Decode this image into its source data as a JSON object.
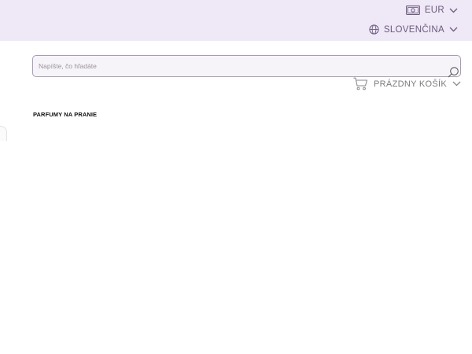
{
  "header": {
    "currency": {
      "label": "EUR",
      "icon": "banknote-icon"
    },
    "language": {
      "label": "SLOVENČINA",
      "icon": "globe-icon"
    }
  },
  "search": {
    "placeholder": "Napíšte, čo hľadáte",
    "value": "",
    "icon": "search-icon"
  },
  "cart": {
    "label": "PRÁZDNY KOŠÍK",
    "icon": "cart-icon"
  },
  "category": {
    "title": "PARFUMY NA PRANIE"
  },
  "colors": {
    "topbar_background": "#efe8f6",
    "topbar_text": "#6b5a7f",
    "search_border": "#a89bb8",
    "cart_text": "#7b7b7b"
  }
}
